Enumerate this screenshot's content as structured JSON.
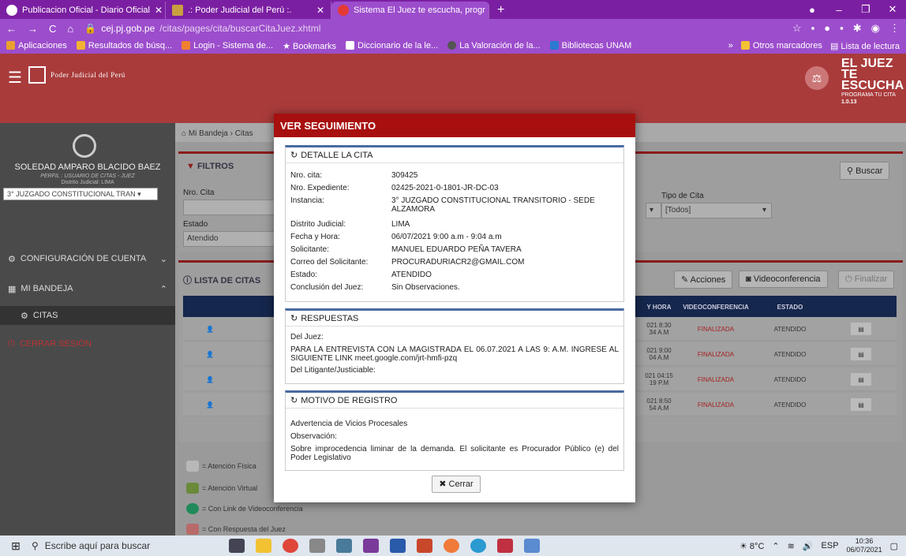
{
  "browser": {
    "tabs": [
      {
        "label": "Publicacion Oficial - Diario Oficial",
        "fav_color": "#ffffff"
      },
      {
        "label": ".: Poder Judicial del Perú :.",
        "fav_color": "#c8a040"
      },
      {
        "label": "Sistema El Juez te escucha, progr",
        "fav_color": "#e53935"
      }
    ],
    "tab_close": "✕",
    "new_tab": "+",
    "url_domain": "cej.pj.gob.pe",
    "url_path": "/citas/pages/cita/buscarCitaJuez.xhtml",
    "bookmarks": [
      "Aplicaciones",
      "Resultados de búsq...",
      "Login - Sistema de...",
      "Bookmarks",
      "Diccionario de la le...",
      "La Valoración de la...",
      "Bibliotecas UNAM"
    ],
    "bookmarks_more": "»",
    "other_bookmarks": "Otros marcadores",
    "reading_list": "Lista de lectura"
  },
  "app": {
    "brand": "Poder Judicial del Perú",
    "juez_title_1": "EL JUEZ TE",
    "juez_title_2": "ESCUCHA",
    "juez_sub": "PROGRAMA TU CITA",
    "version": "1.0.13"
  },
  "sidebar": {
    "user": "SOLEDAD AMPARO BLACIDO BAEZ",
    "perfil": "PERFIL : USUARIO DE CITAS - JUEZ",
    "distrito": "Distrito Judicial: LIMA",
    "juzgado": "3° JUZGADO CONSTITUCIONAL TRAN",
    "config": "CONFIGURACIÓN DE CUENTA",
    "bandeja": "MI BANDEJA",
    "citas": "CITAS",
    "logout": "CERRAR SESIÓN"
  },
  "main": {
    "breadcrumb": "Mi Bandeja › Citas",
    "filtros": "FILTROS",
    "buscar": "Buscar",
    "nro_cita_label": "Nro. Cita",
    "estado_label": "Estado",
    "estado_value": "Atendido",
    "tipo_cita_label": "Tipo de Cita",
    "tipo_cita_value": "[Todos]",
    "lista": "LISTA DE CITAS",
    "acciones": "Acciones",
    "videoconf": "Videoconferencia",
    "finalizar": "Finalizar",
    "headers": [
      "Y HORA",
      "VIDEOCONFERENCIA",
      "ESTADO"
    ],
    "rows": [
      {
        "fecha": "021 8:30",
        "hora": "34 A.M",
        "video": "FINALIZADA",
        "estado": "ATENDIDO"
      },
      {
        "fecha": "021 9:00",
        "hora": "04 A.M",
        "video": "FINALIZADA",
        "estado": "ATENDIDO"
      },
      {
        "fecha": "021 04:15",
        "hora": "19 P.M",
        "video": "FINALIZADA",
        "estado": "ATENDIDO"
      },
      {
        "fecha": "021 8:50",
        "hora": "54 A.M",
        "video": "FINALIZADA",
        "estado": "ATENDIDO"
      }
    ],
    "legend": [
      "= Atención Física",
      "= Atención Virtual",
      "= Con Link de Videoconferencia",
      "= Con Respuesta del Juez"
    ]
  },
  "modal": {
    "title": "VER SEGUIMIENTO",
    "detalle_title": "DETALLE LA CITA",
    "detalle": [
      {
        "k": "Nro. cita:",
        "v": "309425"
      },
      {
        "k": "Nro. Expediente:",
        "v": "02425-2021-0-1801-JR-DC-03"
      },
      {
        "k": "Instancia:",
        "v": "3° JUZGADO CONSTITUCIONAL TRANSITORIO - SEDE ALZAMORA"
      },
      {
        "k": "Distrito Judicial:",
        "v": "LIMA"
      },
      {
        "k": "Fecha y Hora:",
        "v": "06/07/2021 9:00 a.m - 9:04 a.m"
      },
      {
        "k": "Solicitante:",
        "v": "MANUEL EDUARDO PEÑA TAVERA"
      },
      {
        "k": "Correo del Solicitante:",
        "v": "PROCURADURIACR2@GMAIL.COM"
      },
      {
        "k": "Estado:",
        "v": "ATENDIDO"
      },
      {
        "k": "Conclusión del Juez:",
        "v": "Sin Observaciones."
      }
    ],
    "respuestas_title": "RESPUESTAS",
    "del_juez_label": "Del Juez:",
    "del_juez_text": "PARA LA ENTREVISTA CON LA MAGISTRADA EL 06.07.2021 A LAS 9: A.M. INGRESE AL SIGUIENTE LINK meet.google.com/jrt-hmfi-pzq",
    "del_litigante_label": "Del Litigante/Justiciable:",
    "motivo_title": "MOTIVO DE REGISTRO",
    "motivo_text": "Advertencia de Vicios Procesales",
    "observacion_label": "Observación:",
    "observacion_text": "Sobre improcedencia liminar de la demanda. El solicitante es Procurador Público (e) del Poder Legislativo",
    "cerrar": "Cerrar"
  },
  "taskbar": {
    "search_placeholder": "Escribe aquí para buscar",
    "weather": "8°C",
    "lang": "ESP",
    "time": "10:36",
    "date": "06/07/2021"
  }
}
